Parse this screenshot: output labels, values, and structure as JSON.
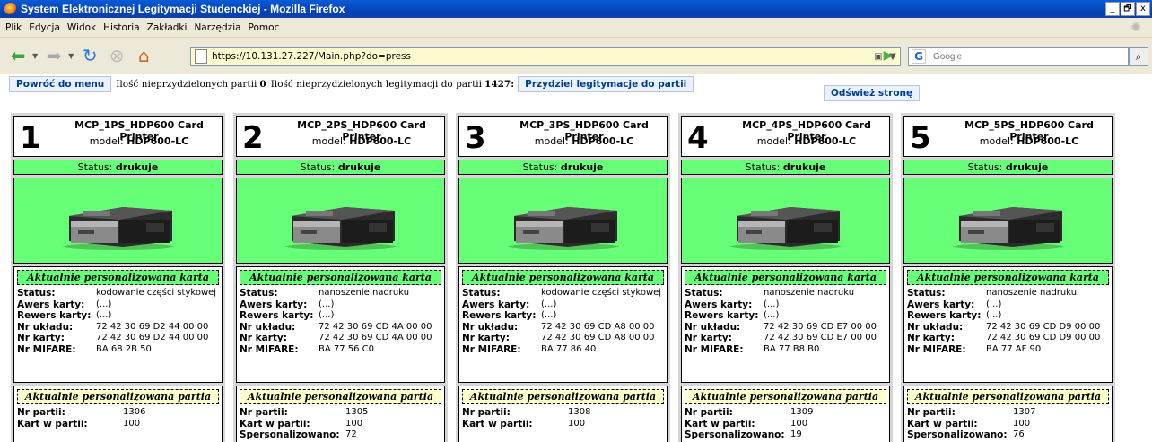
{
  "window": {
    "title": "System Elektronicznej Legitymacji Studenckiej - Mozilla Firefox",
    "buttons": [
      "_",
      "🗗",
      "x"
    ]
  },
  "menu": [
    "Plik",
    "Edycja",
    "Widok",
    "Historia",
    "Zakładki",
    "Narzędzia",
    "Pomoc"
  ],
  "nav": {
    "url": "https://10.131.27.227/Main.php?do=press",
    "search_placeholder": "Google"
  },
  "toolbar": {
    "back_label": "Powróć do menu",
    "unassigned_batches_label": "Ilość nieprzydzielonych partii",
    "unassigned_batches_value": "0",
    "unassigned_ids_label": "Ilość nieprzydzielonych legitymacji do partii",
    "unassigned_ids_value": "1427:",
    "assign_button": "Przydziel legitymacje do partii",
    "refresh_button": "Odśwież stronę"
  },
  "labels": {
    "status": "Status:",
    "model": "model:",
    "current_card": "Aktualnie personalizowana karta",
    "current_batch": "Aktualnie personalizowana partia",
    "awers": "Awers karty:",
    "rewers": "Rewers karty:",
    "nr_ukladu": "Nr układu:",
    "nr_karty": "Nr karty:",
    "nr_mifare": "Nr MIFARE:",
    "nr_partii": "Nr partii:",
    "kart_w_partii": "Kart w partii:",
    "spersonalizowano": "Spersonalizowano:"
  },
  "printers": [
    {
      "num": "1",
      "name": "MCP_1PS_HDP600 Card Printer",
      "model": "HDP600-LC",
      "status": "drukuje",
      "card_status": "kodowanie części stykowej",
      "awers": "(...)",
      "rewers": "(...)",
      "nr_ukladu": "72 42 30 69 D2 44 00 00",
      "nr_karty": "72 42 30 69 D2 44 00 00",
      "nr_mifare": "BA 68 2B 50",
      "nr_partii": "1306",
      "kart_w_partii": "100",
      "spersonalizowano": ""
    },
    {
      "num": "2",
      "name": "MCP_2PS_HDP600 Card Printer",
      "model": "HDP600-LC",
      "status": "drukuje",
      "card_status": "nanoszenie nadruku",
      "awers": "(...)",
      "rewers": "(...)",
      "nr_ukladu": "72 42 30 69 CD 4A 00 00",
      "nr_karty": "72 42 30 69 CD 4A 00 00",
      "nr_mifare": "BA 77 56 C0",
      "nr_partii": "1305",
      "kart_w_partii": "100",
      "spersonalizowano": "72"
    },
    {
      "num": "3",
      "name": "MCP_3PS_HDP600 Card Printer",
      "model": "HDP600-LC",
      "status": "drukuje",
      "card_status": "kodowanie części stykowej",
      "awers": "(...)",
      "rewers": "(...)",
      "nr_ukladu": "72 42 30 69 CD A8 00 00",
      "nr_karty": "72 42 30 69 CD A8 00 00",
      "nr_mifare": "BA 77 86 40",
      "nr_partii": "1308",
      "kart_w_partii": "100",
      "spersonalizowano": ""
    },
    {
      "num": "4",
      "name": "MCP_4PS_HDP600 Card Printer",
      "model": "HDP600-LC",
      "status": "drukuje",
      "card_status": "nanoszenie nadruku",
      "awers": "(...)",
      "rewers": "(...)",
      "nr_ukladu": "72 42 30 69 CD E7 00 00",
      "nr_karty": "72 42 30 69 CD E7 00 00",
      "nr_mifare": "BA 77 B8 B0",
      "nr_partii": "1309",
      "kart_w_partii": "100",
      "spersonalizowano": "19"
    },
    {
      "num": "5",
      "name": "MCP_5PS_HDP600 Card Printer",
      "model": "HDP600-LC",
      "status": "drukuje",
      "card_status": "nanoszenie nadruku",
      "awers": "(...)",
      "rewers": "(...)",
      "nr_ukladu": "72 42 30 69 CD D9 00 00",
      "nr_karty": "72 42 30 69 CD D9 00 00",
      "nr_mifare": "BA 77 AF 90",
      "nr_partii": "1307",
      "kart_w_partii": "100",
      "spersonalizowano": "76"
    }
  ]
}
